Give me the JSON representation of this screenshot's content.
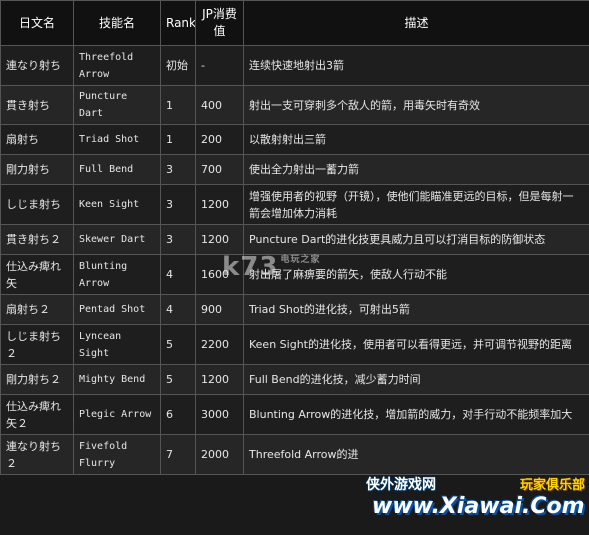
{
  "header": {
    "col_jp": "日文名",
    "col_cn": "技能名",
    "col_rank": "Rank",
    "col_jp_cost": "JP消费值",
    "col_desc": "描述"
  },
  "rows": [
    {
      "jp": "連なり射ち",
      "en": "Threefold Arrow",
      "rank": "初始",
      "cost": "-",
      "desc": "连续快速地射出3箭"
    },
    {
      "jp": "貫き射ち",
      "en": "Puncture Dart",
      "rank": "1",
      "cost": "400",
      "desc": "射出一支可穿刺多个敌人的箭，用毒矢时有奇效"
    },
    {
      "jp": "扇射ち",
      "en": "Triad Shot",
      "rank": "1",
      "cost": "200",
      "desc": "以散射射出三箭"
    },
    {
      "jp": "剛力射ち",
      "en": "Full Bend",
      "rank": "3",
      "cost": "700",
      "desc": "使出全力射出一蓄力箭"
    },
    {
      "jp": "しじま射ち",
      "en": "Keen Sight",
      "rank": "3",
      "cost": "1200",
      "desc": "增强使用者的视野（开镜），使他们能瞄准更远的目标，但是每射一箭会增加体力消耗"
    },
    {
      "jp": "貫き射ち２",
      "en": "Skewer Dart",
      "rank": "3",
      "cost": "1200",
      "desc": "Puncture Dart的进化技更具威力且可以打消目标的防御状态"
    },
    {
      "jp": "仕込み痺れ矢",
      "en": "Blunting Arrow",
      "rank": "4",
      "cost": "1600",
      "desc": "射出屠了麻痹要的箭矢，使敌人行动不能"
    },
    {
      "jp": "扇射ち２",
      "en": "Pentad Shot",
      "rank": "4",
      "cost": "900",
      "desc": "Triad Shot的进化技，可射出5箭"
    },
    {
      "jp": "しじま射ち２",
      "en": "Lyncean Sight",
      "rank": "5",
      "cost": "2200",
      "desc": "Keen Sight的进化技，使用者可以看得更远，并可调节视野的距离"
    },
    {
      "jp": "剛力射ち２",
      "en": "Mighty Bend",
      "rank": "5",
      "cost": "1200",
      "desc": "Full Bend的进化技，减少蓄力时间"
    },
    {
      "jp": "仕込み痺れ矢２",
      "en": "Plegic Arrow",
      "rank": "6",
      "cost": "3000",
      "desc": "Blunting Arrow的进化技，增加箭的威力，对手行动不能频率加大"
    },
    {
      "jp": "連なり射ち２",
      "en": "Fivefold Flurry",
      "rank": "7",
      "cost": "2000",
      "desc": "Threefold Arrow的进"
    }
  ],
  "watermark_k73": {
    "text": "k73",
    "small": "电玩之家"
  },
  "watermark_xiawai": {
    "left": "侠外游戏网",
    "right": "玩家俱乐部",
    "url": "www.Xiawai.Com"
  }
}
